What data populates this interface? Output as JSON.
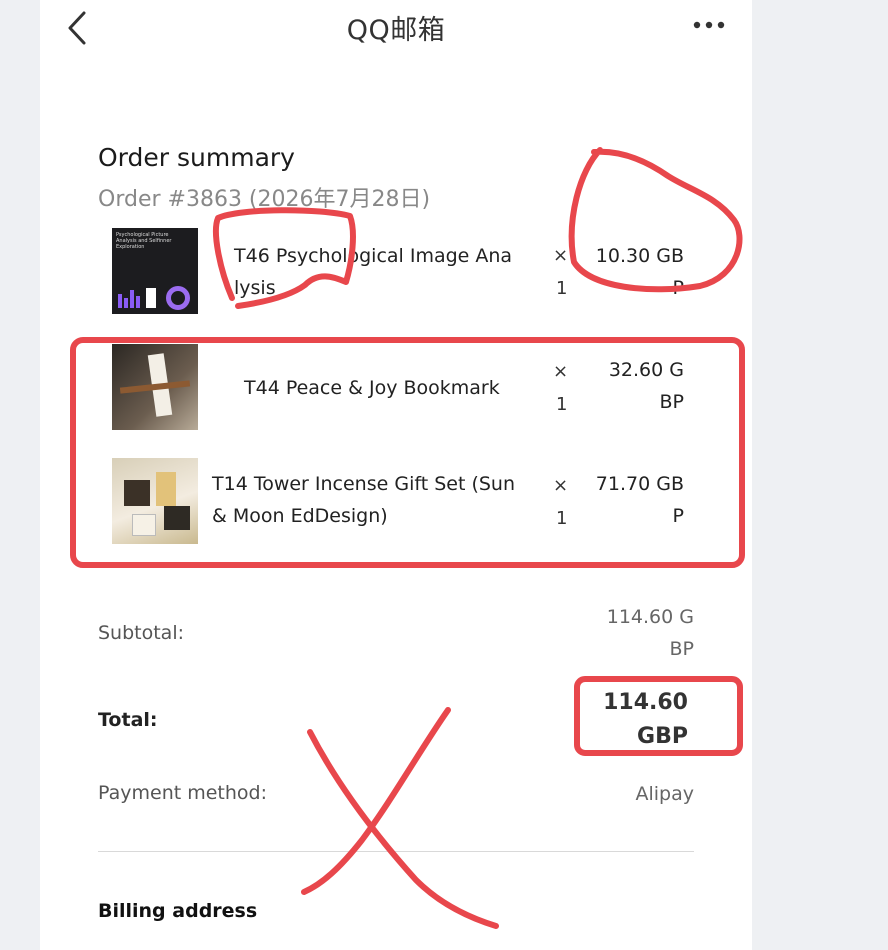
{
  "nav": {
    "title": "QQ邮箱"
  },
  "summary": {
    "title": "Order summary",
    "order_line": "Order #3863 (2026年7月28日)"
  },
  "items": [
    {
      "name_line1": "T46 Psychological Image Ana",
      "name_line2": "lysis",
      "qty_x": "×",
      "qty_n": "1",
      "price_line1": "10.30  GB",
      "price_line2": "P",
      "thumb_text": "Psychological Picture Analysis and Selfinner Exploration"
    },
    {
      "name_line1": "T44 Peace & Joy Bookmark",
      "name_line2": "",
      "qty_x": "×",
      "qty_n": "1",
      "price_line1": "32.60  G",
      "price_line2": "BP"
    },
    {
      "name_line1": "T14 Tower Incense Gift Set (Sun",
      "name_line2": "& Moon EdDesign)",
      "qty_x": "×",
      "qty_n": "1",
      "price_line1": "71.70  GB",
      "price_line2": "P"
    }
  ],
  "totals": {
    "subtotal_label": "Subtotal:",
    "subtotal_line1": "114.60  G",
    "subtotal_line2": "BP",
    "total_label": "Total:",
    "total_line1": "114.60",
    "total_line2": "GBP",
    "payment_label": "Payment method:",
    "payment_value": "Alipay"
  },
  "billing": {
    "title": "Billing address"
  },
  "colors": {
    "annotation_red": "#e8474c",
    "background": "#eef0f3"
  },
  "icons": [
    "back-chevron-icon",
    "more-dots-icon"
  ]
}
